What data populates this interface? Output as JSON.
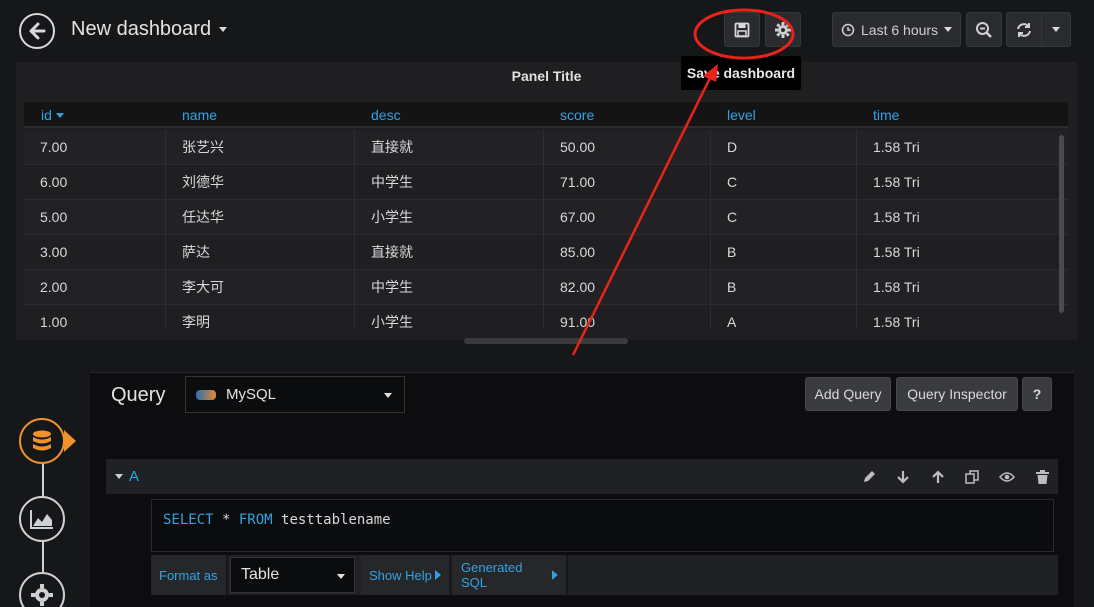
{
  "navbar": {
    "title": "New dashboard",
    "time_range": "Last 6 hours",
    "save_tooltip": "Save dashboard"
  },
  "panel": {
    "title": "Panel Title",
    "columns": [
      "id",
      "name",
      "desc",
      "score",
      "level",
      "time"
    ],
    "rows": [
      [
        "7.00",
        "张艺兴",
        "直接就",
        "50.00",
        "D",
        "1.58 Tri"
      ],
      [
        "6.00",
        "刘德华",
        "中学生",
        "71.00",
        "C",
        "1.58 Tri"
      ],
      [
        "5.00",
        "任达华",
        "小学生",
        "67.00",
        "C",
        "1.58 Tri"
      ],
      [
        "3.00",
        "萨达",
        "直接就",
        "85.00",
        "B",
        "1.58 Tri"
      ],
      [
        "2.00",
        "李大可",
        "中学生",
        "82.00",
        "B",
        "1.58 Tri"
      ],
      [
        "1.00",
        "李明",
        "小学生",
        "91.00",
        "A",
        "1.58 Tri"
      ]
    ]
  },
  "query_editor": {
    "title": "Query",
    "datasource": "MySQL",
    "add_query": "Add Query",
    "query_inspector": "Query Inspector",
    "help": "?",
    "query_ref": "A",
    "sql_keyword_1": "SELECT",
    "sql_mid": " * ",
    "sql_keyword_2": "FROM",
    "sql_rest": " testtablename",
    "format_as_label": "Format as",
    "format_value": "Table",
    "show_help": "Show Help",
    "generated_sql": "Generated SQL"
  },
  "colors": {
    "accent_blue": "#33a2e5",
    "active_orange": "#f0912b",
    "annotation_red": "#e8231a"
  }
}
